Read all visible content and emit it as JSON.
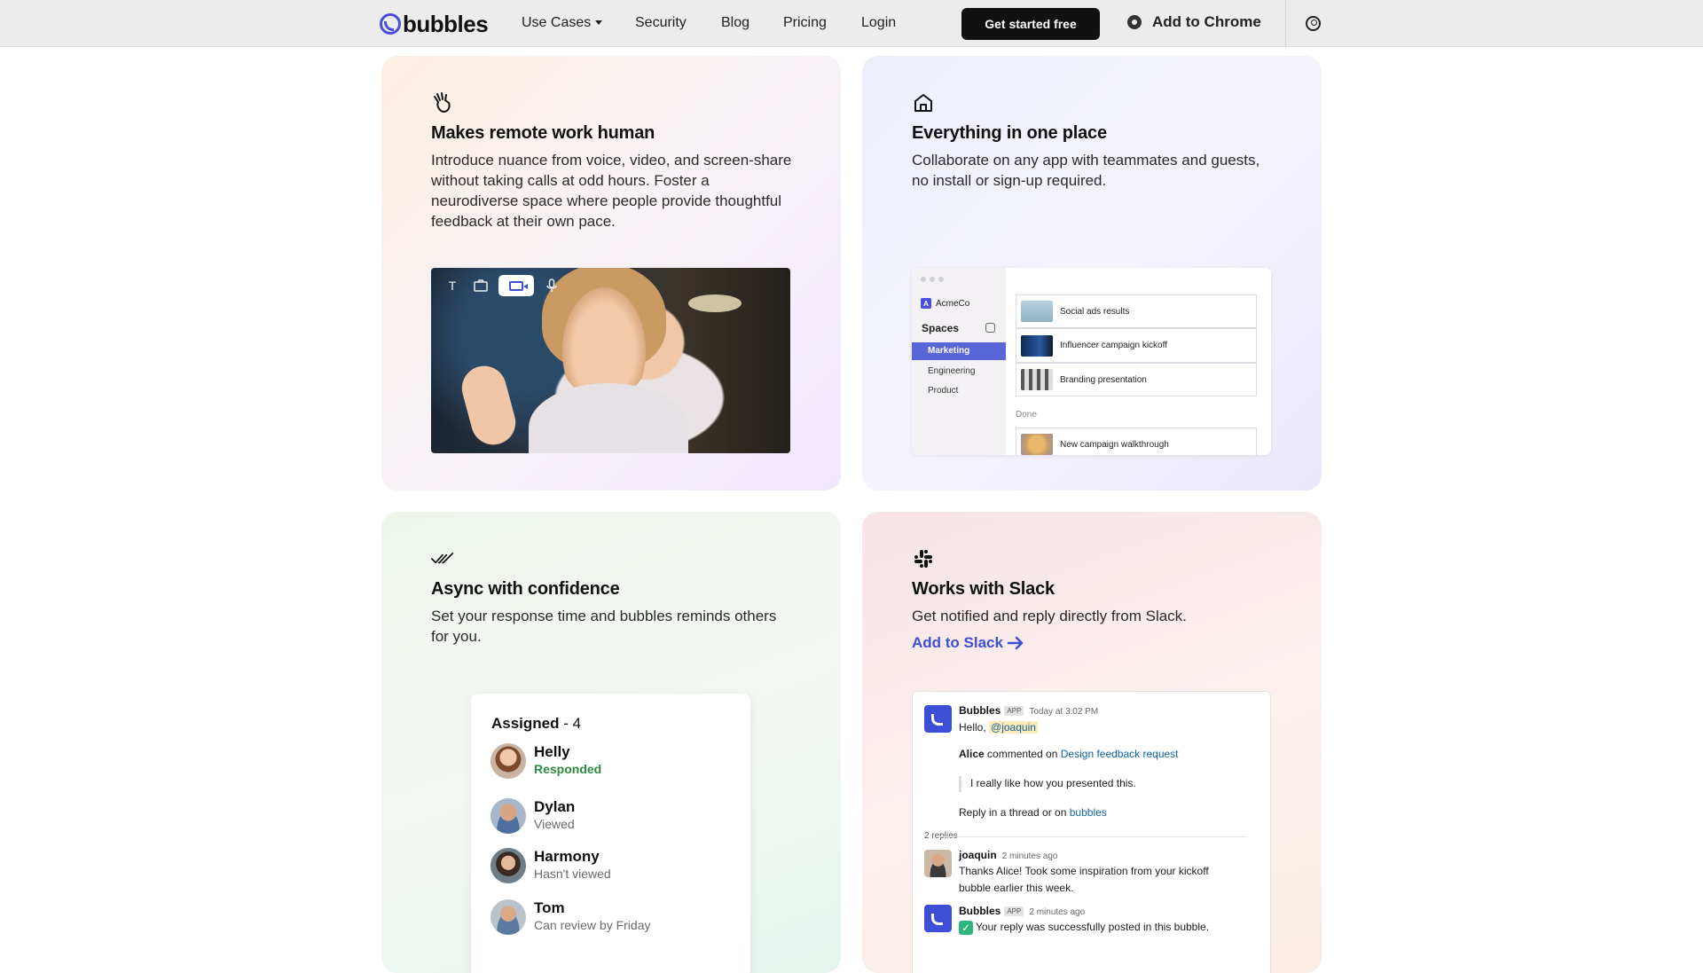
{
  "nav": {
    "logo_text": "bubbles",
    "links": [
      "Use Cases",
      "Security",
      "Blog",
      "Pricing",
      "Login"
    ],
    "cta": "Get started free",
    "chrome": "Add to Chrome"
  },
  "cards": [
    {
      "title": "Makes remote work human",
      "desc": "Introduce nuance from voice, video, and screen-share without taking calls at odd hours. Foster a neurodiverse space where people provide thoughtful feedback at their own pace."
    },
    {
      "title": "Everything in one place",
      "desc": "Collaborate on any app with teammates and guests, no install or sign-up required."
    },
    {
      "title": "Async with confidence",
      "desc": "Set your response time and bubbles reminds others for you."
    },
    {
      "title": "Works with Slack",
      "desc": "Get notified and reply directly from Slack.",
      "link": "Add to Slack"
    }
  ],
  "video_tools": [
    "T"
  ],
  "app_mock": {
    "org": "AcmeCo",
    "org_badge": "A",
    "spaces_label": "Spaces",
    "spaces": [
      "Marketing",
      "Engineering",
      "Product"
    ],
    "tasks": [
      "Social ads results",
      "Influencer campaign kickoff",
      "Branding presentation"
    ],
    "done_label": "Done",
    "done_task": "New campaign walkthrough"
  },
  "assigned": {
    "title": "Assigned",
    "count": "- 4",
    "people": [
      {
        "name": "Helly",
        "status": "Responded"
      },
      {
        "name": "Dylan",
        "status": "Viewed"
      },
      {
        "name": "Harmony",
        "status": "Hasn't viewed"
      },
      {
        "name": "Tom",
        "status": "Can review by Friday"
      }
    ]
  },
  "slack_mock": {
    "bot_name": "Bubbles",
    "app_badge": "APP",
    "time1": "Today at 3:02 PM",
    "hello": "Hello,",
    "mention": "@joaquin",
    "commenter": "Alice",
    "commented_on": "commented on",
    "doc_link": "Design feedback request",
    "quote": "I really like how you presented this.",
    "reply_hint": "Reply in a thread or on",
    "reply_link": "bubbles",
    "replies": "2 replies",
    "user2": "joaquin",
    "time2": "2 minutes ago",
    "msg2_line1": "Thanks Alice! Took some inspiration from your kickoff",
    "msg2_line2": "bubble earlier this week.",
    "time3": "2 minutes ago",
    "msg3": "Your reply was successfully posted in this bubble."
  },
  "colors": {
    "brand": "#4b4fe0",
    "link": "#3d4fd6",
    "nav_bg": "#ececec"
  }
}
